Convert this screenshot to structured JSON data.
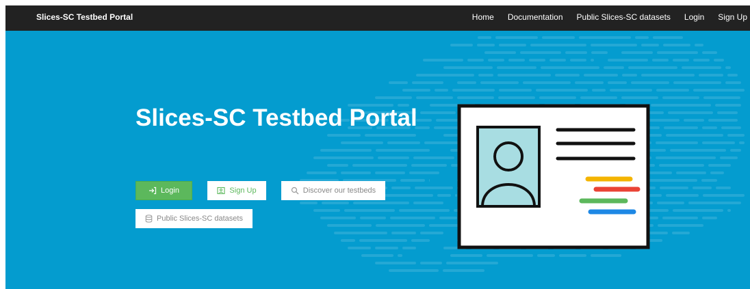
{
  "navbar": {
    "brand": "Slices-SC Testbed Portal",
    "links": [
      {
        "label": "Home"
      },
      {
        "label": "Documentation"
      },
      {
        "label": "Public Slices-SC datasets"
      },
      {
        "label": "Login"
      },
      {
        "label": "Sign Up"
      }
    ]
  },
  "hero": {
    "title": "Slices-SC Testbed Portal",
    "buttons": {
      "login": {
        "label": "Login",
        "icon": "sign-in-icon"
      },
      "signup": {
        "label": "Sign Up",
        "icon": "user-card-icon"
      },
      "discover": {
        "label": "Discover our testbeds",
        "icon": "search-icon"
      },
      "datasets": {
        "label": "Public Slices-SC datasets",
        "icon": "database-icon"
      }
    }
  },
  "colors": {
    "navbar_bg": "#222222",
    "hero_bg": "#049ccf",
    "success": "#5cb85c",
    "accent_yellow": "#f4b400",
    "accent_red": "#ea4335",
    "accent_green": "#5cb85c",
    "accent_blue": "#1e88e5"
  }
}
